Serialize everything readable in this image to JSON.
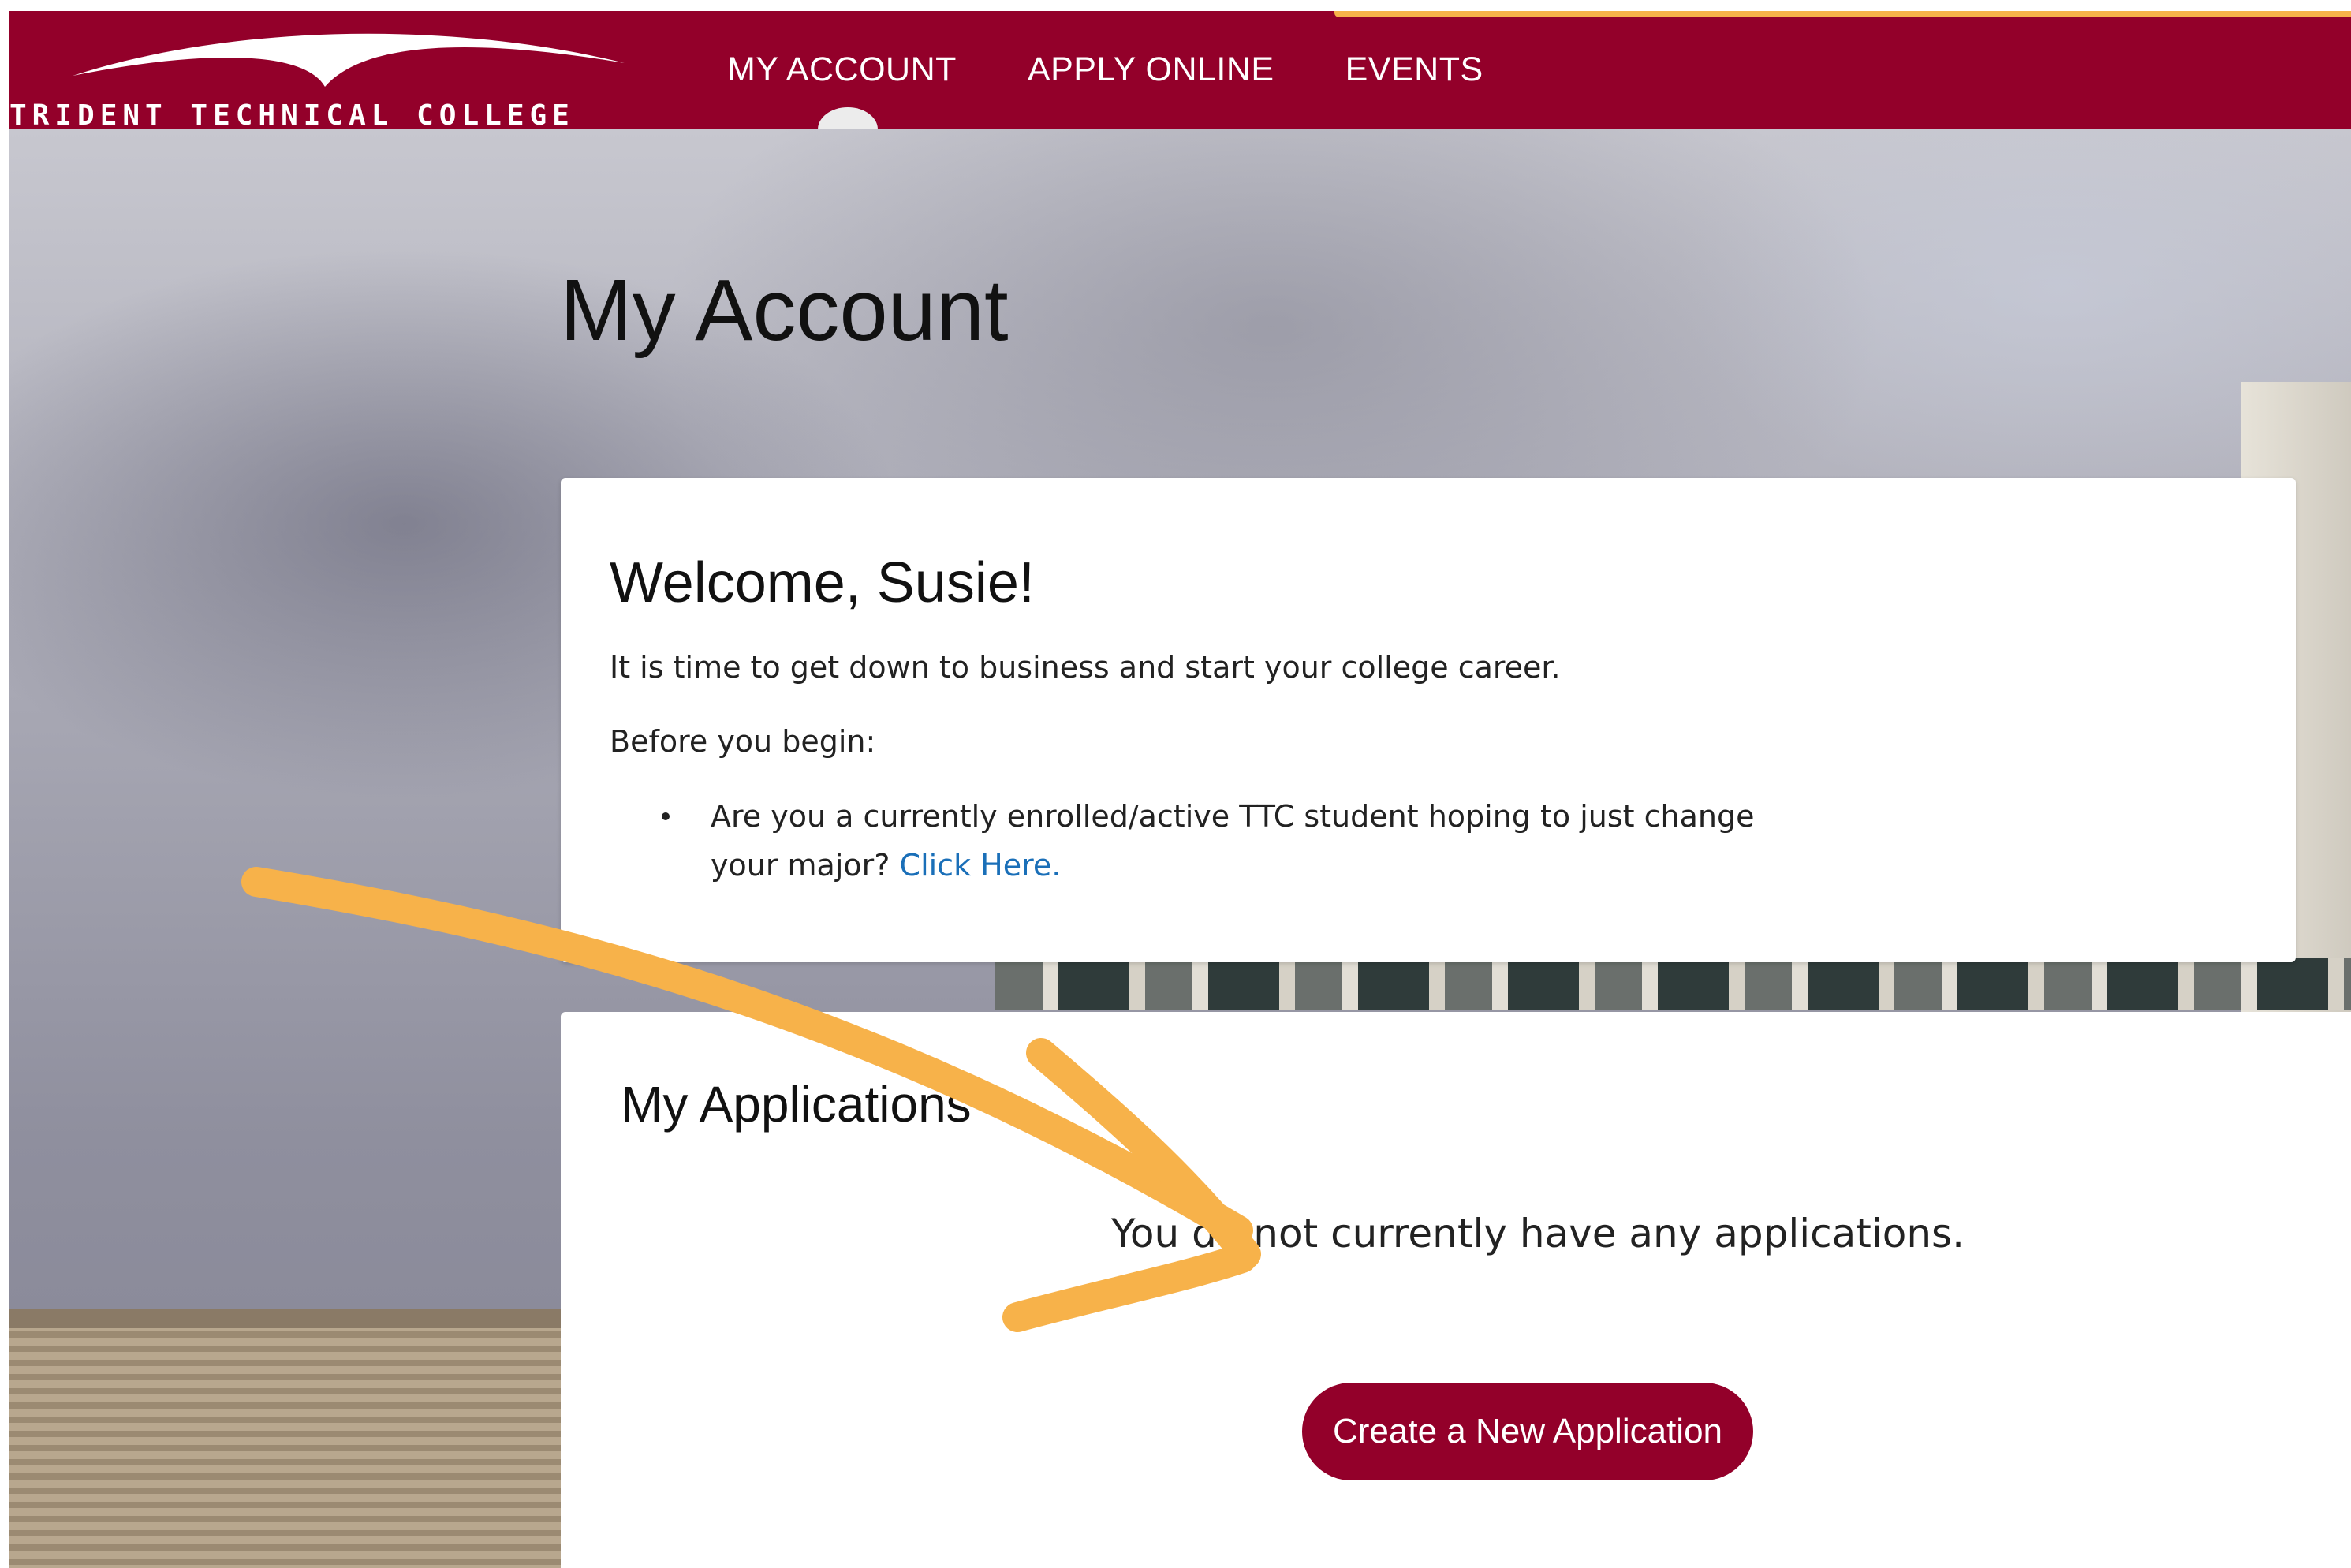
{
  "brand": {
    "name": "TRIDENT TECHNICAL COLLEGE",
    "primary_color": "#93002a",
    "accent_color": "#f7b24a",
    "link_color": "#1a6fb8"
  },
  "nav": {
    "items": [
      "MY ACCOUNT",
      "APPLY ONLINE",
      "EVENTS"
    ],
    "active": "MY ACCOUNT"
  },
  "page": {
    "title": "My Account"
  },
  "welcome": {
    "heading": "Welcome, Susie!",
    "intro": "It is time to get down to business and start your college career.",
    "before": "Before you begin:",
    "bullet_text": "Are you a currently enrolled/active TTC student hoping to just change your major?",
    "bullet_link": "Click Here."
  },
  "applications": {
    "heading": "My Applications",
    "empty_message": "You do not currently have any applications.",
    "create_button": "Create a New Application"
  },
  "annotation": {
    "type": "hand-drawn arrow",
    "color": "#f7b24a",
    "points_to": "applications.empty_message"
  }
}
